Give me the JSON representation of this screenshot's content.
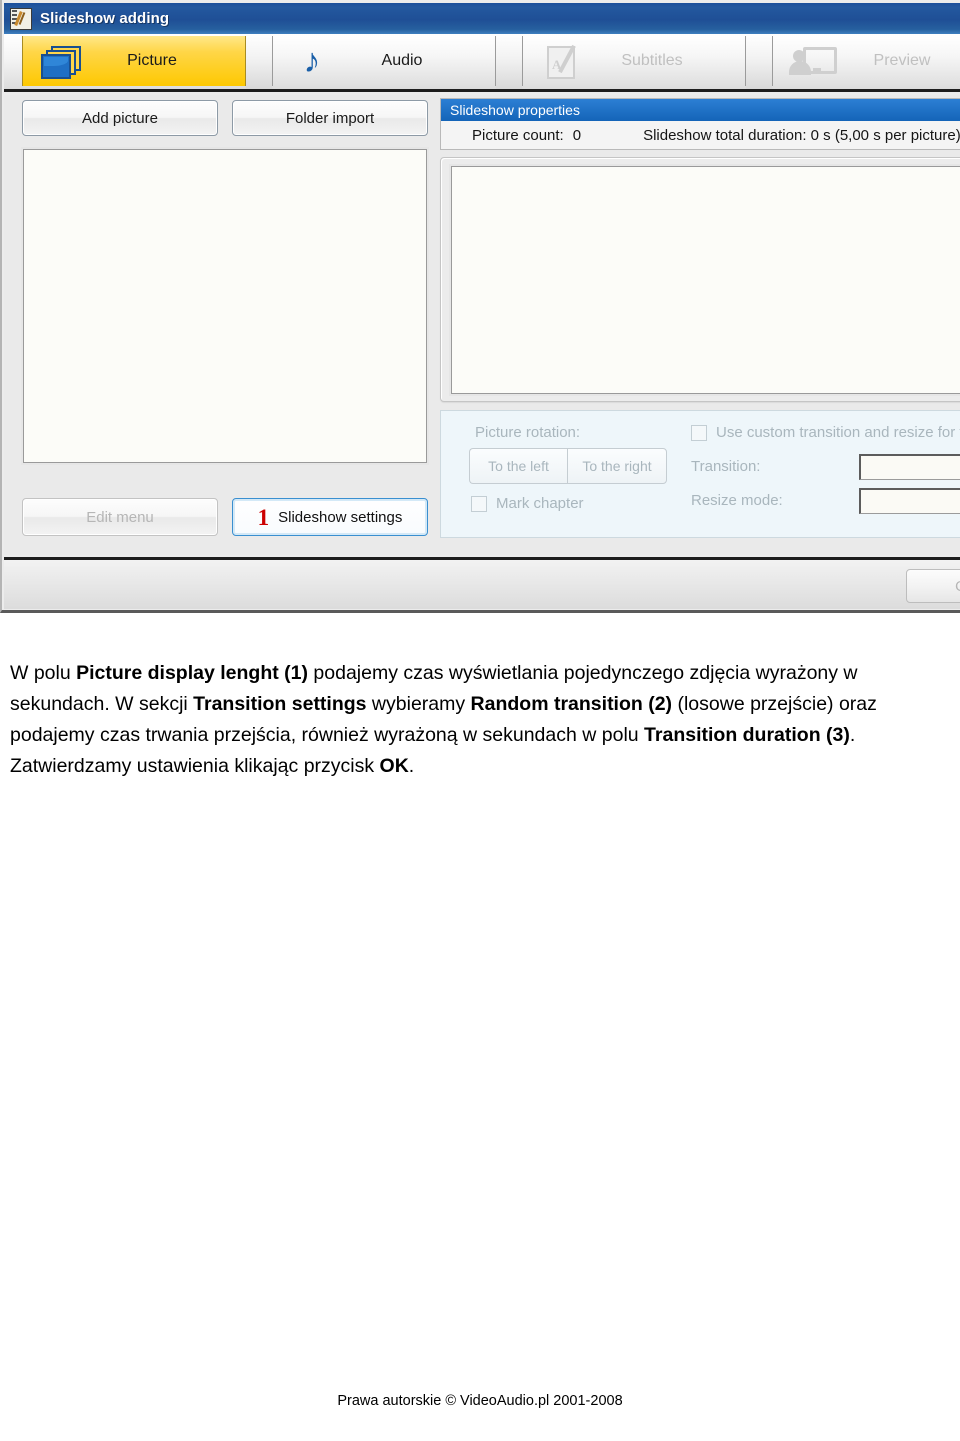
{
  "window": {
    "title": "Slideshow adding",
    "title_icon": "slideshow-app-icon"
  },
  "tabs": [
    {
      "label": "Picture",
      "icon": "pictures-stack-icon",
      "selected": true,
      "disabled": false
    },
    {
      "label": "Audio",
      "icon": "music-note-icon",
      "selected": false,
      "disabled": false
    },
    {
      "label": "Subtitles",
      "icon": "subtitles-icon",
      "selected": false,
      "disabled": true
    },
    {
      "label": "Preview",
      "icon": "preview-monitor-icon",
      "selected": false,
      "disabled": true
    }
  ],
  "left_panel": {
    "add_picture_label": "Add picture",
    "folder_import_label": "Folder import",
    "edit_menu_label": "Edit menu",
    "slideshow_settings_label": "Slideshow settings",
    "slideshow_settings_badge": "1",
    "picture_list_items": []
  },
  "slideshow_properties": {
    "header": "Slideshow properties",
    "picture_count_label": "Picture count:",
    "picture_count_value": "0",
    "total_duration": "Slideshow total duration: 0 s (5,00 s per picture)"
  },
  "picture_options": {
    "picture_rotation_label": "Picture rotation:",
    "rotate_left_label": "To the left",
    "rotate_right_label": "To the right",
    "mark_chapter_label": "Mark chapter",
    "mark_chapter_checked": false,
    "use_custom_label": "Use custom transition and resize for t",
    "use_custom_checked": false,
    "transition_label": "Transition:",
    "transition_value": "",
    "resize_mode_label": "Resize mode:",
    "resize_mode_value": ""
  },
  "footer": {
    "ok_label": "OK"
  },
  "body_text": {
    "p1_a": "W polu ",
    "p1_b": "Picture display lenght (1)",
    "p1_c": " podajemy czas wyświetlania pojedynczego zdjęcia wyrażony w sekundach. W sekcji ",
    "p1_d": "Transition settings",
    "p1_e": " wybieramy ",
    "p1_f": "Random transition (2)",
    "p1_g": " (losowe przejście) oraz podajemy czas trwania przejścia, również wyrażoną w sekundach w polu ",
    "p1_h": "Transition duration (3)",
    "p1_i": ". Zatwierdzamy ustawienia klikając przycisk ",
    "p1_j": "OK",
    "p1_k": "."
  },
  "page_footer": {
    "copyright": "Prawa autorskie © VideoAudio.pl 2001-2008"
  },
  "colors": {
    "titlebar_blue": "#1f4f96",
    "tab_selected_yellow": "#fdc800",
    "properties_header_blue": "#1464b8",
    "badge_red": "#cc0000",
    "options_panel_bg": "#eef6fa"
  }
}
